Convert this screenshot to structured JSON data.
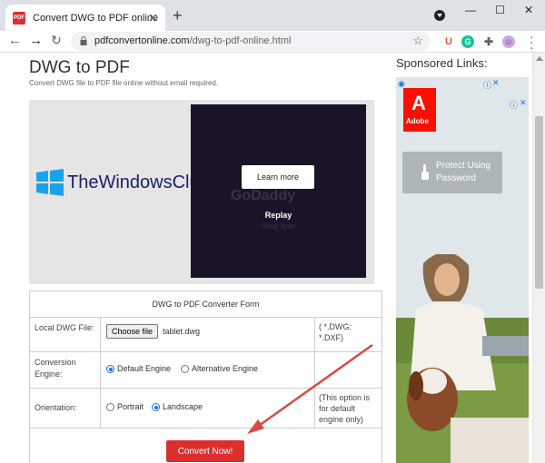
{
  "browser": {
    "tab_title": "Convert DWG to PDF online",
    "favicon_text": "PDF",
    "url_host": "pdfconvertonline.com",
    "url_path": "/dwg-to-pdf-online.html",
    "extensions": [
      {
        "name": "u-ext-icon",
        "letter": "U",
        "color": "#e8542e"
      },
      {
        "name": "grammarly-icon",
        "letter": "G",
        "color": "#15c39a"
      },
      {
        "name": "puzzle-icon",
        "letter": "",
        "color": "#5f6368"
      },
      {
        "name": "profile-avatar",
        "letter": "",
        "color": "#c9a8e0"
      }
    ]
  },
  "page": {
    "heading": "DWG to PDF",
    "subheading": "Convert DWG file to PDF file online without email required.",
    "watermark": "TheWindowsClub",
    "ad": {
      "learn_more": "Learn more",
      "brand": "GoDaddy",
      "replay": "Replay",
      "shop_now": "Shop Now"
    },
    "form": {
      "title": "DWG to PDF Converter Form",
      "file_label": "Local DWG File:",
      "choose_file": "Choose file",
      "file_name": "tablet.dwg",
      "file_hint": "( *.DWG; *.DXF)",
      "engine_label": "Conversion Engine:",
      "engine_default": "Default Engine",
      "engine_alt": "Alternative Engine",
      "orientation_label": "Orientation:",
      "portrait": "Portrait",
      "landscape": "Landscape",
      "orientation_hint": "(This option is for default engine only)",
      "convert": "Convert Now!"
    }
  },
  "sidebar": {
    "sponsored": "Sponsored Links:",
    "adobe": "Adobe",
    "protect_text": "Protect Using Password"
  },
  "colors": {
    "convert_button": "#d9302e",
    "adobe_red": "#fa0f00",
    "ad_dark": "#1b1327"
  }
}
